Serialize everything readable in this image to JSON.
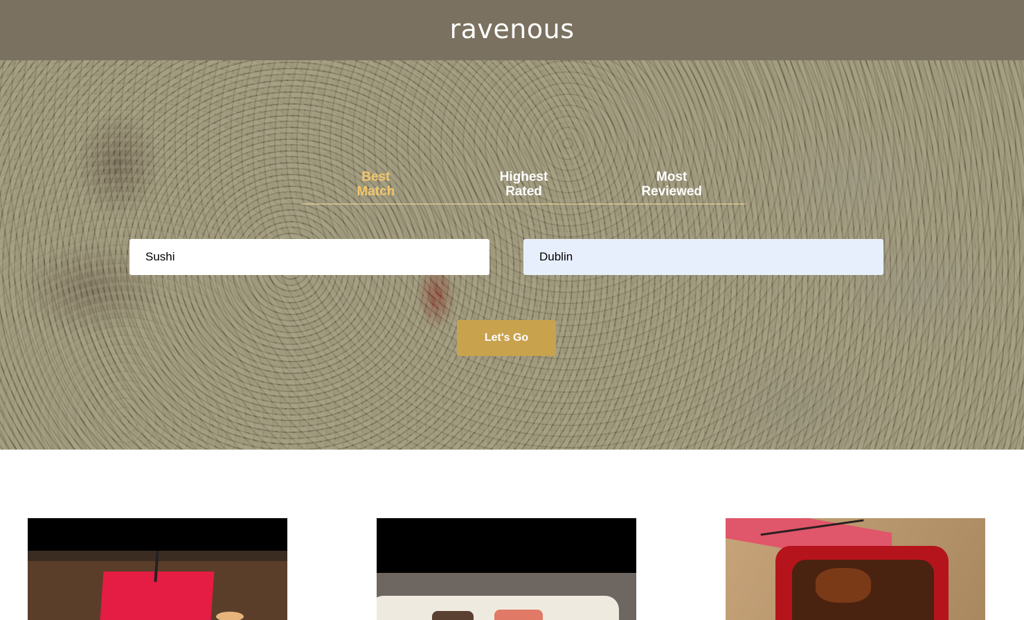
{
  "header": {
    "logo_text": "ravenous"
  },
  "sort_options": [
    {
      "label_line1": "Best",
      "label_line2": "Match",
      "active": true
    },
    {
      "label_line1": "Highest",
      "label_line2": "Rated",
      "active": false
    },
    {
      "label_line1": "Most",
      "label_line2": "Reviewed",
      "active": false
    }
  ],
  "search": {
    "term_value": "Sushi",
    "location_value": "Dublin",
    "submit_label": "Let's Go"
  },
  "colors": {
    "header_bg": "#7a7160",
    "active_tab": "#f2c66d",
    "button_bg": "#c9a24e",
    "location_field_bg": "#e8effc"
  }
}
